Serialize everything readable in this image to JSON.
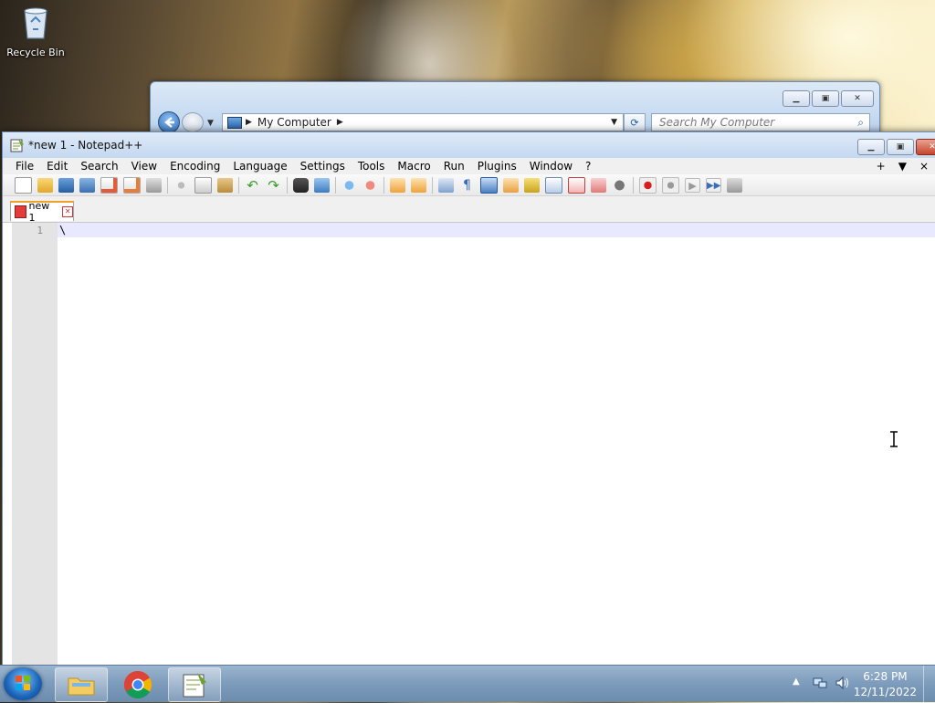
{
  "desktop": {
    "recycle_bin_label": "Recycle Bin"
  },
  "explorer": {
    "address_text": "My Computer",
    "search_placeholder": "Search My Computer"
  },
  "notepad": {
    "title": "*new 1 - Notepad++",
    "menu": [
      "File",
      "Edit",
      "Search",
      "View",
      "Encoding",
      "Language",
      "Settings",
      "Tools",
      "Macro",
      "Run",
      "Plugins",
      "Window",
      "?"
    ],
    "menu_right_plus": "+",
    "menu_right_arrow": "▼",
    "menu_right_close": "×",
    "tab_label": "new 1",
    "line_number": "1",
    "line_content": "\\"
  },
  "taskbar": {
    "time": "6:28 PM",
    "date": "12/11/2022"
  },
  "colors": {
    "tab_accent": "#f4a026",
    "current_line": "#e8e8ff"
  }
}
